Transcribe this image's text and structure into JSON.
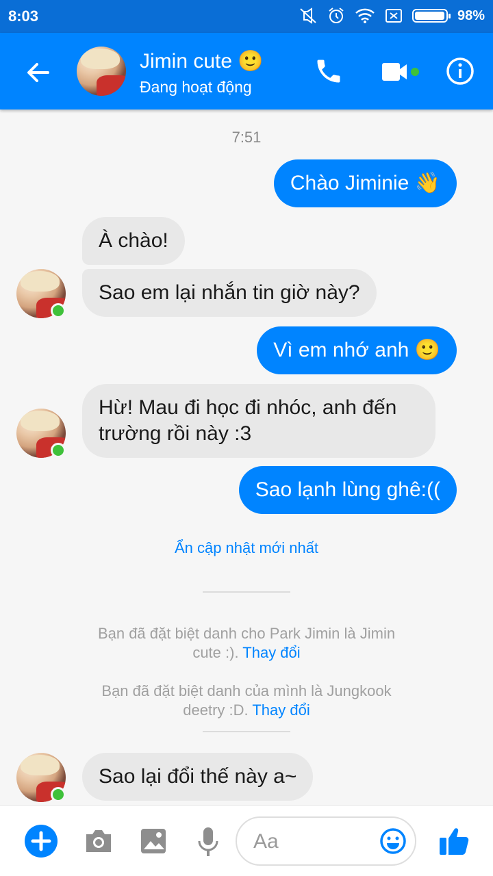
{
  "status_bar": {
    "time": "8:03",
    "battery_percent": "98%",
    "battery_level": 0.98,
    "icons": [
      "mute-icon",
      "alarm-icon",
      "wifi-icon",
      "no-sim-icon",
      "battery-icon"
    ]
  },
  "header": {
    "contact_name": "Jimin cute",
    "contact_emoji": "🙂",
    "status": "Đang hoạt động",
    "accent": "#0084ff",
    "status_bar_color": "#0a6ed6",
    "online_dot_color": "#3fc13a"
  },
  "chat": {
    "timestamp": "7:51",
    "messages": [
      {
        "from": "me",
        "text": "Chào Jiminie 👋"
      },
      {
        "from": "them",
        "text": "À chào!"
      },
      {
        "from": "them",
        "text": "Sao em lại nhắn tin giờ này?"
      },
      {
        "from": "me",
        "text": "Vì em nhớ anh 🙂"
      },
      {
        "from": "them",
        "text_line1": "Hừ! Mau đi học đi nhóc, anh đến",
        "text_line2": "trường rồi này :3"
      },
      {
        "from": "me",
        "text": "Sao lạnh lùng ghê:(("
      },
      {
        "from": "them",
        "text": "Sao lại đổi thế này a~"
      }
    ],
    "hide_updates": "Ẩn cập nhật mới nhất",
    "notices": [
      {
        "line1": "Bạn đã đặt biệt danh cho Park Jimin là Jimin",
        "line2": "cute :).",
        "action": "Thay đổi"
      },
      {
        "line1": "Bạn đã đặt biệt danh của mình là Jungkook",
        "line2": "deetry :D.",
        "action": "Thay đổi"
      }
    ]
  },
  "composer": {
    "placeholder": "Aa"
  }
}
